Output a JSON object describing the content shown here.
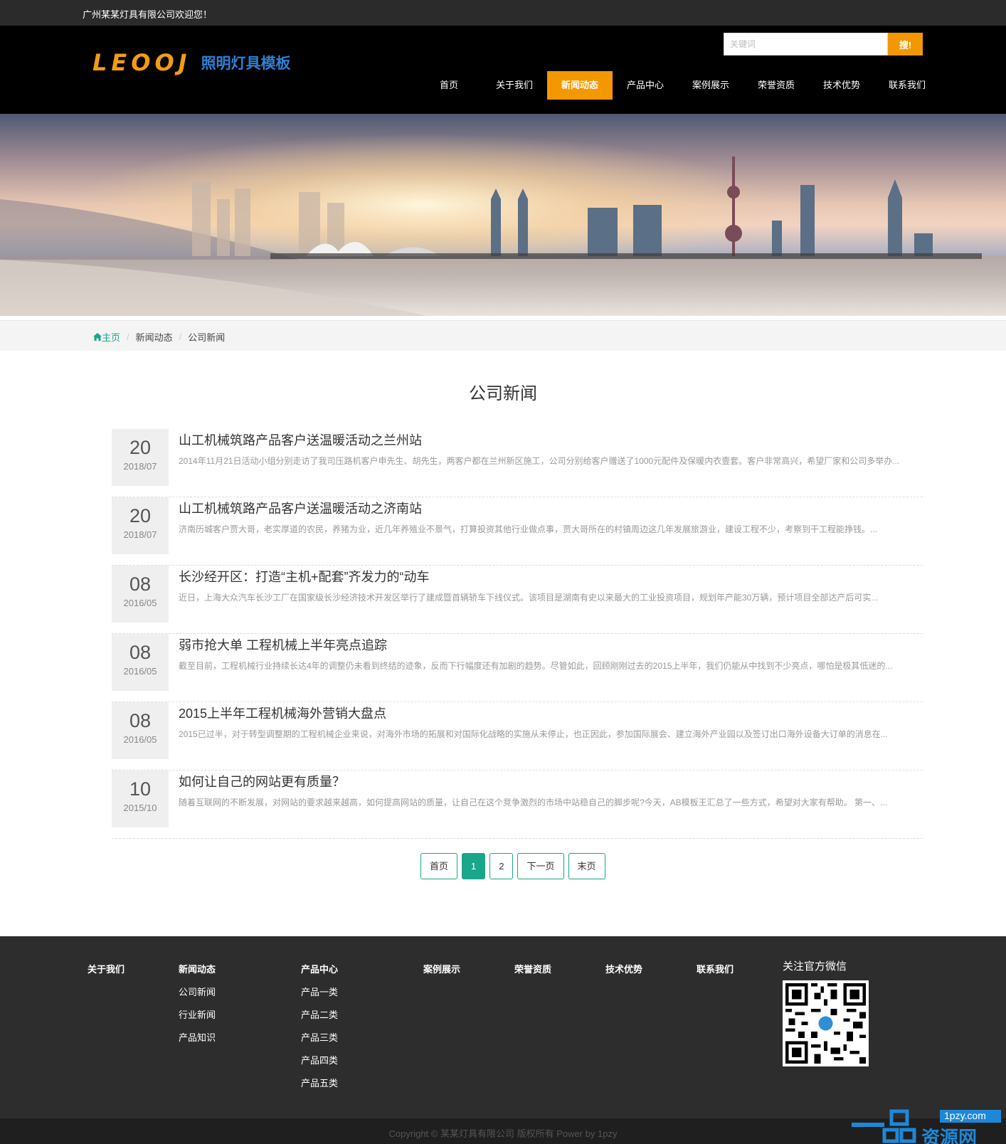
{
  "topbar": {
    "welcome": "广州某某灯具有限公司欢迎您！"
  },
  "logo": {
    "mark": "LEOOJ",
    "tagline": "照明灯具模板"
  },
  "search": {
    "placeholder": "关键词",
    "button": "搜!"
  },
  "nav": {
    "items": [
      {
        "label": "首页"
      },
      {
        "label": "关于我们"
      },
      {
        "label": "新闻动态",
        "active": true
      },
      {
        "label": "产品中心"
      },
      {
        "label": "案例展示"
      },
      {
        "label": "荣誉资质"
      },
      {
        "label": "技术优势"
      },
      {
        "label": "联系我们"
      }
    ]
  },
  "breadcrumb": {
    "home": "主页",
    "level1": "新闻动态",
    "level2": "公司新闻"
  },
  "page_title": "公司新闻",
  "news": [
    {
      "day": "20",
      "ym": "2018/07",
      "title": "山工机械筑路产品客户送温暖活动之兰州站",
      "desc": "2014年11月21日活动小组分别走访了我司压路机客户申先生、胡先生，两客户都在兰州新区施工，公司分别给客户赠送了1000元配件及保暖内衣壹套。客户非常高兴，希望厂家和公司多举办..."
    },
    {
      "day": "20",
      "ym": "2018/07",
      "title": "山工机械筑路产品客户送温暖活动之济南站",
      "desc": "济南历城客户贾大哥，老实厚道的农民，养猪为业，近几年养殖业不景气，打算投资其他行业做点事，贾大哥所在的村镇周边这几年发展旅游业，建设工程不少，考察到干工程能挣钱。..."
    },
    {
      "day": "08",
      "ym": "2016/05",
      "title": "长沙经开区：打造“主机+配套”齐发力的“动车",
      "desc": "近日，上海大众汽车长沙工厂在国家级长沙经济技术开发区举行了建成暨首辆轿车下线仪式。该项目是湖南有史以来最大的工业投资项目，规划年产能30万辆，预计项目全部达产后可实..."
    },
    {
      "day": "08",
      "ym": "2016/05",
      "title": "弱市抢大单 工程机械上半年亮点追踪",
      "desc": "截至目前，工程机械行业持续长达4年的调整仍未看到终结的迹象，反而下行幅度还有加剧的趋势。尽管如此，回顾刚刚过去的2015上半年，我们仍能从中找到不少亮点，哪怕是极其低迷的..."
    },
    {
      "day": "08",
      "ym": "2016/05",
      "title": "2015上半年工程机械海外营销大盘点",
      "desc": "2015已过半，对于转型调整期的工程机械企业来说，对海外市场的拓展和对国际化战略的实施从未停止，也正因此，参加国际展会、建立海外产业园以及签订出口海外设备大订单的消息在..."
    },
    {
      "day": "10",
      "ym": "2015/10",
      "title": "如何让自己的网站更有质量？",
      "desc": "随着互联网的不断发展，对网站的要求越来越高，如何提高网站的质量，让自己在这个竞争激烈的市场中站稳自己的脚步呢?今天，AB模板王汇总了一些方式，希望对大家有帮助。 第一、..."
    }
  ],
  "pagination": {
    "first": "首页",
    "p1": "1",
    "p2": "2",
    "next": "下一页",
    "last": "末页",
    "current": 1
  },
  "footer": {
    "about": {
      "head": "关于我们"
    },
    "news": {
      "head": "新闻动态",
      "links": [
        "公司新闻",
        "行业新闻",
        "产品知识"
      ]
    },
    "products": {
      "head": "产品中心",
      "links": [
        "产品一类",
        "产品二类",
        "产品三类",
        "产品四类",
        "产品五类"
      ]
    },
    "cases": {
      "head": "案例展示"
    },
    "honors": {
      "head": "荣誉资质"
    },
    "tech": {
      "head": "技术优势"
    },
    "contact": {
      "head": "联系我们"
    },
    "wechat": {
      "head": "关注官方微信"
    }
  },
  "copyright": "Copyright © 某某灯具有限公司 版权所有 Power by 1pzy",
  "watermark": {
    "domain": "1pzy.com",
    "text": "资源网"
  },
  "colors": {
    "accent": "#f39800",
    "teal": "#19a68a",
    "header": "#000000",
    "footer": "#2d2d2d",
    "logo_blue": "#2f7fd6"
  }
}
